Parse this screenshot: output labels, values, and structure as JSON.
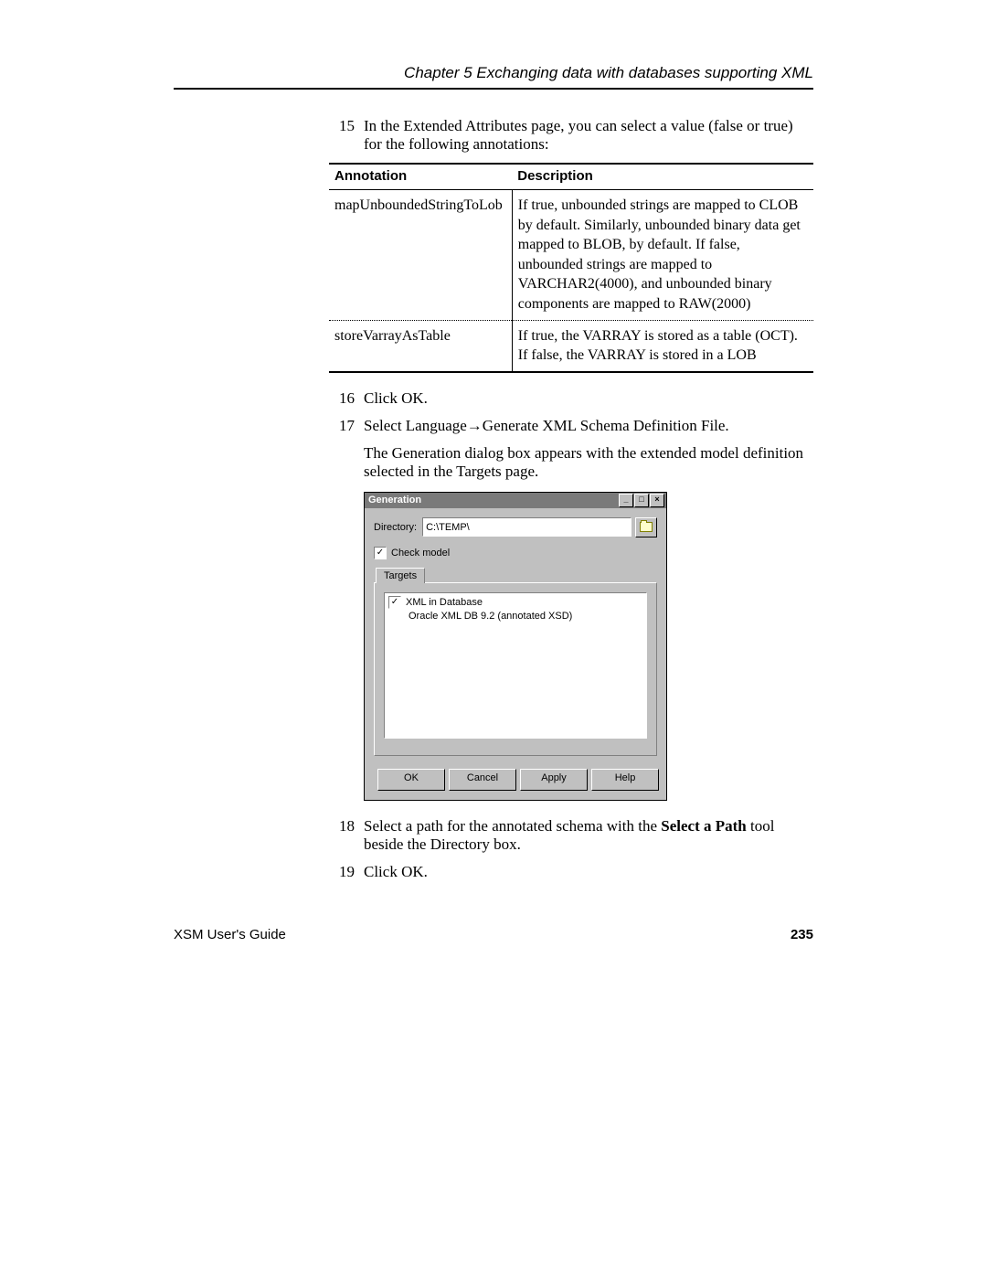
{
  "header": {
    "chapter": "Chapter 5    Exchanging data with databases supporting XML"
  },
  "steps": {
    "s15": {
      "num": "15",
      "text": "In the Extended Attributes page, you can select a value (false or true) for the following annotations:"
    },
    "s16": {
      "num": "16",
      "text": "Click OK."
    },
    "s17": {
      "num": "17",
      "text": "Select Language→Generate XML Schema Definition File.",
      "sub": "The Generation dialog box appears with the extended model definition selected in the Targets page."
    },
    "s18": {
      "num": "18",
      "text_prefix": "Select a path for the annotated schema with the ",
      "bold": "Select a Path",
      "text_suffix": " tool beside the Directory box."
    },
    "s19": {
      "num": "19",
      "text": "Click OK."
    }
  },
  "table": {
    "h1": "Annotation",
    "h2": "Description",
    "row1": {
      "a": "mapUnboundedStringToLob",
      "d": "If true, unbounded strings are mapped to CLOB by default. Similarly, unbounded binary data get mapped to BLOB, by default. If false, unbounded strings are mapped to VARCHAR2(4000), and unbounded binary components are mapped to RAW(2000)"
    },
    "row2": {
      "a": "storeVarrayAsTable",
      "d": "If true, the VARRAY is stored as a table (OCT). If false, the VARRAY is stored in a LOB"
    }
  },
  "dialog": {
    "title": "Generation",
    "directory_label": "Directory:",
    "directory_value": "C:\\TEMP\\",
    "check_model": "Check model",
    "tab": "Targets",
    "tree_root": "XML in Database",
    "tree_child": "Oracle XML DB 9.2 (annotated XSD)",
    "buttons": {
      "ok": "OK",
      "cancel": "Cancel",
      "apply": "Apply",
      "help": "Help"
    }
  },
  "footer": {
    "left": "XSM User's Guide",
    "page": "235"
  }
}
